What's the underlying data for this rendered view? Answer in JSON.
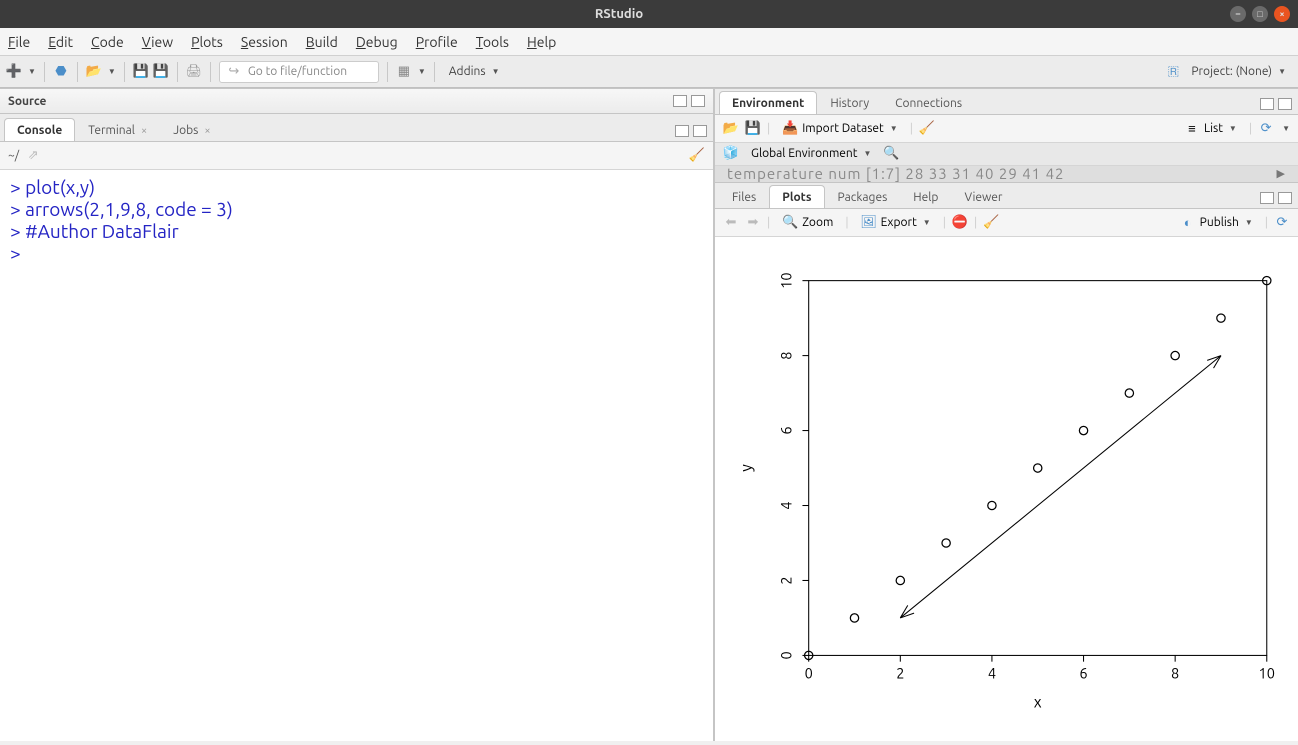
{
  "title": "RStudio",
  "menu": [
    "File",
    "Edit",
    "Code",
    "View",
    "Plots",
    "Session",
    "Build",
    "Debug",
    "Profile",
    "Tools",
    "Help"
  ],
  "mainbar": {
    "goto_placeholder": "Go to file/function",
    "addins": "Addins",
    "project": "Project: (None)"
  },
  "left": {
    "source_label": "Source",
    "tabs": {
      "console": "Console",
      "terminal": "Terminal",
      "jobs": "Jobs"
    },
    "path": "~/",
    "console_lines": [
      "> plot(x,y)",
      "> arrows(2,1,9,8, code = 3)",
      "> #Author DataFlair",
      "> "
    ]
  },
  "right_top": {
    "tabs": {
      "env": "Environment",
      "history": "History",
      "connections": "Connections"
    },
    "import": "Import Dataset",
    "list": "List",
    "global_env": "Global Environment",
    "ghost": "temperature  num [1:7] 28 33 31 40 29 41 42"
  },
  "right_bottom": {
    "tabs": {
      "files": "Files",
      "plots": "Plots",
      "packages": "Packages",
      "help": "Help",
      "viewer": "Viewer"
    },
    "zoom": "Zoom",
    "export": "Export",
    "publish": "Publish"
  },
  "chart_data": {
    "type": "scatter",
    "xlabel": "x",
    "ylabel": "y",
    "xlim": [
      0,
      10
    ],
    "ylim": [
      0,
      10
    ],
    "x_ticks": [
      0,
      2,
      4,
      6,
      8,
      10
    ],
    "y_ticks": [
      0,
      2,
      4,
      6,
      8,
      10
    ],
    "x": [
      0,
      1,
      2,
      3,
      4,
      5,
      6,
      7,
      8,
      9,
      10
    ],
    "y": [
      0,
      1,
      2,
      3,
      4,
      5,
      6,
      7,
      8,
      9,
      10
    ],
    "annotations": [
      {
        "kind": "double_arrow",
        "x0": 2,
        "y0": 1,
        "x1": 9,
        "y1": 8
      }
    ]
  }
}
